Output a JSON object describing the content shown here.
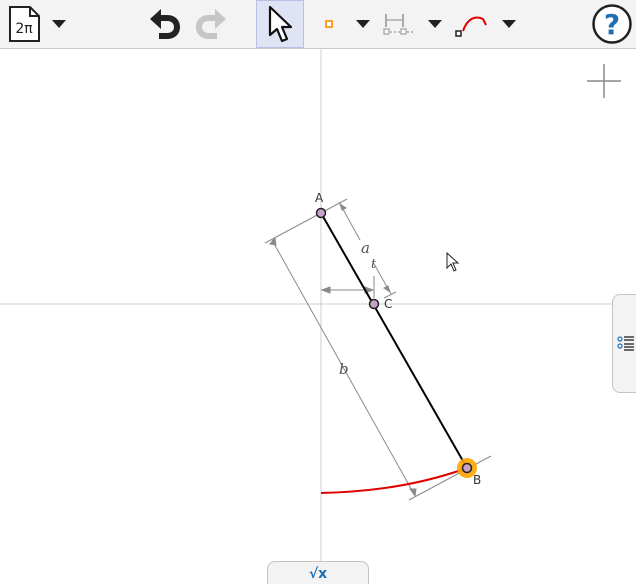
{
  "toolbar": {
    "file_icon_text": "2π",
    "tools": [
      {
        "name": "file-menu",
        "icon": "document-2pi-icon"
      },
      {
        "name": "undo",
        "icon": "undo-icon"
      },
      {
        "name": "redo",
        "icon": "redo-icon"
      },
      {
        "name": "move",
        "icon": "pointer-arrow-icon",
        "active": true
      },
      {
        "name": "point",
        "icon": "point-icon"
      },
      {
        "name": "measure",
        "icon": "measure-distance-icon"
      },
      {
        "name": "locus",
        "icon": "locus-curve-icon"
      },
      {
        "name": "help",
        "icon": "help-icon"
      }
    ],
    "accent": "#ff8c00",
    "help_color": "#1f6fb5"
  },
  "canvas": {
    "points": [
      {
        "label": "A"
      },
      {
        "label": "B"
      },
      {
        "label": "C"
      }
    ],
    "measurements": [
      {
        "label": "a"
      },
      {
        "label": "b"
      },
      {
        "label": "t"
      }
    ],
    "curve_color": "#e00000",
    "segment_color": "#000000",
    "point_color": "#c8a2c8",
    "selected_halo_color": "#ffa500"
  },
  "algebra_tab": {
    "icon": "sqrt-x-icon",
    "label": "√x"
  },
  "side_panel": {
    "icon": "list-view-icon"
  }
}
